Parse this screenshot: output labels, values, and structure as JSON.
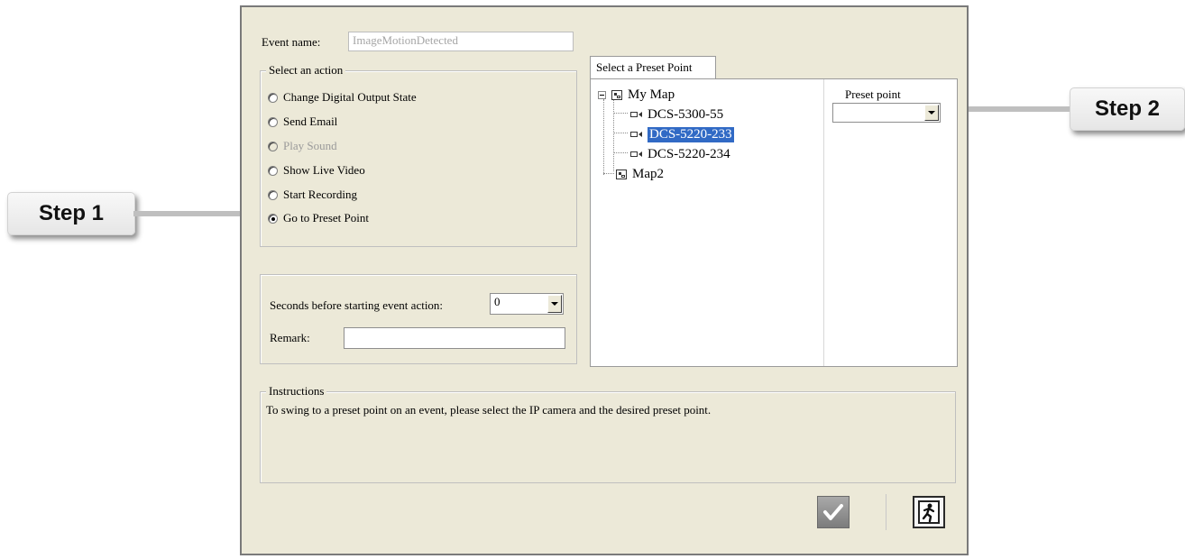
{
  "dialog": {
    "event_name_label": "Event name:",
    "event_name_value": "ImageMotionDetected",
    "select_action_legend": "Select an action",
    "actions": [
      {
        "label": "Change Digital Output State",
        "checked": false,
        "disabled": false
      },
      {
        "label": "Send Email",
        "checked": false,
        "disabled": false
      },
      {
        "label": "Play Sound",
        "checked": false,
        "disabled": true
      },
      {
        "label": "Show Live Video",
        "checked": false,
        "disabled": false
      },
      {
        "label": "Start Recording",
        "checked": false,
        "disabled": false
      },
      {
        "label": "Go to Preset Point",
        "checked": true,
        "disabled": false
      }
    ],
    "seconds_label": "Seconds before starting event action:",
    "seconds_value": "0",
    "remark_label": "Remark:",
    "remark_value": "",
    "preset_tab_label": "Select a Preset Point",
    "tree": {
      "root": "My Map",
      "cameras": [
        "DCS-5300-55",
        "DCS-5220-233",
        "DCS-5220-234"
      ],
      "selected_camera": "DCS-5220-233",
      "map2": "Map2"
    },
    "preset_point_label": "Preset point",
    "preset_point_value": "",
    "instructions_legend": "Instructions",
    "instructions_text": "To swing to a preset point on an event, please select the IP camera and the desired preset point."
  },
  "callouts": {
    "step1": "Step 1",
    "step2": "Step 2"
  },
  "icons": {
    "ok": "checkmark-icon",
    "exit": "exit-running-man-icon"
  },
  "colors": {
    "dialog_bg": "#ece9d8",
    "selection": "#316ac5"
  }
}
